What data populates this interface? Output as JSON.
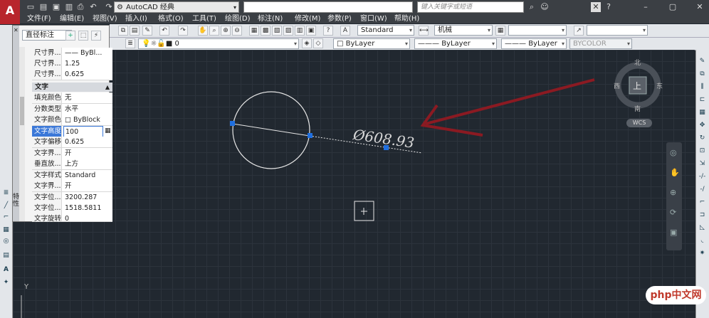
{
  "title_bar": {
    "workspace": "AutoCAD 经典",
    "search_placeholder": "键入关键字或短语"
  },
  "menu": [
    "文件(F)",
    "编辑(E)",
    "视图(V)",
    "插入(I)",
    "格式(O)",
    "工具(T)",
    "绘图(D)",
    "标注(N)",
    "修改(M)",
    "参数(P)",
    "窗口(W)",
    "帮助(H)"
  ],
  "toolbar": {
    "text_style": "Standard",
    "dim_style": "机械",
    "layer": "0",
    "color": "ByLayer",
    "linetype": "ByLayer",
    "lineweight": "ByLayer",
    "plotstyle": "BYCOLOR"
  },
  "properties": {
    "object_type": "直径标注",
    "rows_top": [
      {
        "key": "尺寸界...",
        "value": "—— ByBl..."
      },
      {
        "key": "尺寸界...",
        "value": "1.25"
      },
      {
        "key": "尺寸界...",
        "value": "0.625"
      }
    ],
    "section_text": "文字",
    "rows_text": [
      {
        "key": "填充颜色",
        "value": "无"
      },
      {
        "key": "分数类型",
        "value": "水平"
      },
      {
        "key": "文字颜色",
        "value": "□ ByBlock"
      },
      {
        "key": "文字高度",
        "value": "100"
      },
      {
        "key": "文字偏移",
        "value": "0.625"
      },
      {
        "key": "文字界...",
        "value": "开"
      },
      {
        "key": "垂直放...",
        "value": "上方"
      },
      {
        "key": "文字样式",
        "value": "Standard"
      },
      {
        "key": "文字界...",
        "value": "开"
      },
      {
        "key": "文字位...",
        "value": "3200.287"
      },
      {
        "key": "文字位...",
        "value": "1518.5811"
      },
      {
        "key": "文字旋转",
        "value": "0"
      }
    ],
    "side_label": "特性"
  },
  "drawing": {
    "dimension_text": "Ø608.93"
  },
  "viewcube": {
    "north": "北",
    "south": "南",
    "east": "东",
    "west": "西",
    "top": "上",
    "wcs": "WCS"
  },
  "ucs": {
    "y_label": "Y"
  },
  "watermark": "php中文网",
  "colors": {
    "arrow": "#8b1a22",
    "grip": "#1f6fe0",
    "selection": "#3b78d8"
  }
}
